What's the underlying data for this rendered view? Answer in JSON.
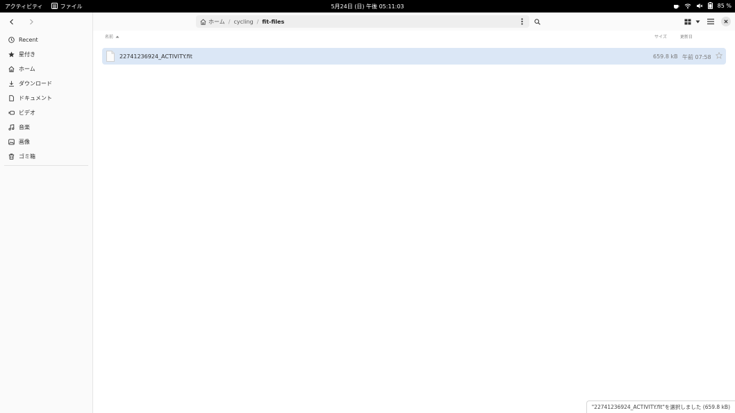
{
  "topbar": {
    "activities": "アクティビティ",
    "app_name": "ファイル",
    "clock": "5月24日 (日) 午後 05:11:03",
    "battery": "85 %"
  },
  "sidebar": {
    "items": [
      {
        "label": "Recent",
        "icon": "clock-icon"
      },
      {
        "label": "星付き",
        "icon": "star-icon"
      },
      {
        "label": "ホーム",
        "icon": "home-icon"
      },
      {
        "label": "ダウンロード",
        "icon": "download-icon"
      },
      {
        "label": "ドキュメント",
        "icon": "document-icon"
      },
      {
        "label": "ビデオ",
        "icon": "video-icon"
      },
      {
        "label": "音楽",
        "icon": "music-icon"
      },
      {
        "label": "画像",
        "icon": "picture-icon"
      },
      {
        "label": "ゴミ箱",
        "icon": "trash-icon"
      }
    ]
  },
  "path": {
    "home": "ホーム",
    "segments": [
      "cycling",
      "fit-files"
    ]
  },
  "columns": {
    "name": "名前",
    "size": "サイズ",
    "modified": "更新日"
  },
  "files": [
    {
      "name": "22741236924_ACTIVITY.fit",
      "size": "659.8 kB",
      "modified": "午前 07:58",
      "selected": true
    }
  ],
  "status": "\"22741236924_ACTIVITY.fit\"を選択しました (659.8 kB)",
  "colors": {
    "selection": "#dbe7f6",
    "topbar": "#000000",
    "sidebar": "#fafafa"
  }
}
